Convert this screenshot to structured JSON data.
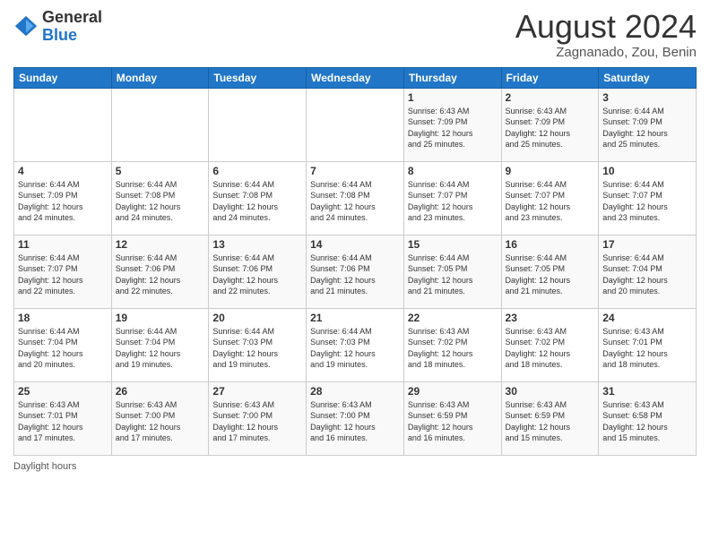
{
  "header": {
    "logo_general": "General",
    "logo_blue": "Blue",
    "title": "August 2024",
    "subtitle": "Zagnanado, Zou, Benin"
  },
  "days_of_week": [
    "Sunday",
    "Monday",
    "Tuesday",
    "Wednesday",
    "Thursday",
    "Friday",
    "Saturday"
  ],
  "weeks": [
    [
      {
        "day": "",
        "info": ""
      },
      {
        "day": "",
        "info": ""
      },
      {
        "day": "",
        "info": ""
      },
      {
        "day": "",
        "info": ""
      },
      {
        "day": "1",
        "info": "Sunrise: 6:43 AM\nSunset: 7:09 PM\nDaylight: 12 hours\nand 25 minutes."
      },
      {
        "day": "2",
        "info": "Sunrise: 6:43 AM\nSunset: 7:09 PM\nDaylight: 12 hours\nand 25 minutes."
      },
      {
        "day": "3",
        "info": "Sunrise: 6:44 AM\nSunset: 7:09 PM\nDaylight: 12 hours\nand 25 minutes."
      }
    ],
    [
      {
        "day": "4",
        "info": "Sunrise: 6:44 AM\nSunset: 7:09 PM\nDaylight: 12 hours\nand 24 minutes."
      },
      {
        "day": "5",
        "info": "Sunrise: 6:44 AM\nSunset: 7:08 PM\nDaylight: 12 hours\nand 24 minutes."
      },
      {
        "day": "6",
        "info": "Sunrise: 6:44 AM\nSunset: 7:08 PM\nDaylight: 12 hours\nand 24 minutes."
      },
      {
        "day": "7",
        "info": "Sunrise: 6:44 AM\nSunset: 7:08 PM\nDaylight: 12 hours\nand 24 minutes."
      },
      {
        "day": "8",
        "info": "Sunrise: 6:44 AM\nSunset: 7:07 PM\nDaylight: 12 hours\nand 23 minutes."
      },
      {
        "day": "9",
        "info": "Sunrise: 6:44 AM\nSunset: 7:07 PM\nDaylight: 12 hours\nand 23 minutes."
      },
      {
        "day": "10",
        "info": "Sunrise: 6:44 AM\nSunset: 7:07 PM\nDaylight: 12 hours\nand 23 minutes."
      }
    ],
    [
      {
        "day": "11",
        "info": "Sunrise: 6:44 AM\nSunset: 7:07 PM\nDaylight: 12 hours\nand 22 minutes."
      },
      {
        "day": "12",
        "info": "Sunrise: 6:44 AM\nSunset: 7:06 PM\nDaylight: 12 hours\nand 22 minutes."
      },
      {
        "day": "13",
        "info": "Sunrise: 6:44 AM\nSunset: 7:06 PM\nDaylight: 12 hours\nand 22 minutes."
      },
      {
        "day": "14",
        "info": "Sunrise: 6:44 AM\nSunset: 7:06 PM\nDaylight: 12 hours\nand 21 minutes."
      },
      {
        "day": "15",
        "info": "Sunrise: 6:44 AM\nSunset: 7:05 PM\nDaylight: 12 hours\nand 21 minutes."
      },
      {
        "day": "16",
        "info": "Sunrise: 6:44 AM\nSunset: 7:05 PM\nDaylight: 12 hours\nand 21 minutes."
      },
      {
        "day": "17",
        "info": "Sunrise: 6:44 AM\nSunset: 7:04 PM\nDaylight: 12 hours\nand 20 minutes."
      }
    ],
    [
      {
        "day": "18",
        "info": "Sunrise: 6:44 AM\nSunset: 7:04 PM\nDaylight: 12 hours\nand 20 minutes."
      },
      {
        "day": "19",
        "info": "Sunrise: 6:44 AM\nSunset: 7:04 PM\nDaylight: 12 hours\nand 19 minutes."
      },
      {
        "day": "20",
        "info": "Sunrise: 6:44 AM\nSunset: 7:03 PM\nDaylight: 12 hours\nand 19 minutes."
      },
      {
        "day": "21",
        "info": "Sunrise: 6:44 AM\nSunset: 7:03 PM\nDaylight: 12 hours\nand 19 minutes."
      },
      {
        "day": "22",
        "info": "Sunrise: 6:43 AM\nSunset: 7:02 PM\nDaylight: 12 hours\nand 18 minutes."
      },
      {
        "day": "23",
        "info": "Sunrise: 6:43 AM\nSunset: 7:02 PM\nDaylight: 12 hours\nand 18 minutes."
      },
      {
        "day": "24",
        "info": "Sunrise: 6:43 AM\nSunset: 7:01 PM\nDaylight: 12 hours\nand 18 minutes."
      }
    ],
    [
      {
        "day": "25",
        "info": "Sunrise: 6:43 AM\nSunset: 7:01 PM\nDaylight: 12 hours\nand 17 minutes."
      },
      {
        "day": "26",
        "info": "Sunrise: 6:43 AM\nSunset: 7:00 PM\nDaylight: 12 hours\nand 17 minutes."
      },
      {
        "day": "27",
        "info": "Sunrise: 6:43 AM\nSunset: 7:00 PM\nDaylight: 12 hours\nand 17 minutes."
      },
      {
        "day": "28",
        "info": "Sunrise: 6:43 AM\nSunset: 7:00 PM\nDaylight: 12 hours\nand 16 minutes."
      },
      {
        "day": "29",
        "info": "Sunrise: 6:43 AM\nSunset: 6:59 PM\nDaylight: 12 hours\nand 16 minutes."
      },
      {
        "day": "30",
        "info": "Sunrise: 6:43 AM\nSunset: 6:59 PM\nDaylight: 12 hours\nand 15 minutes."
      },
      {
        "day": "31",
        "info": "Sunrise: 6:43 AM\nSunset: 6:58 PM\nDaylight: 12 hours\nand 15 minutes."
      }
    ]
  ],
  "footer": {
    "daylight_label": "Daylight hours"
  }
}
